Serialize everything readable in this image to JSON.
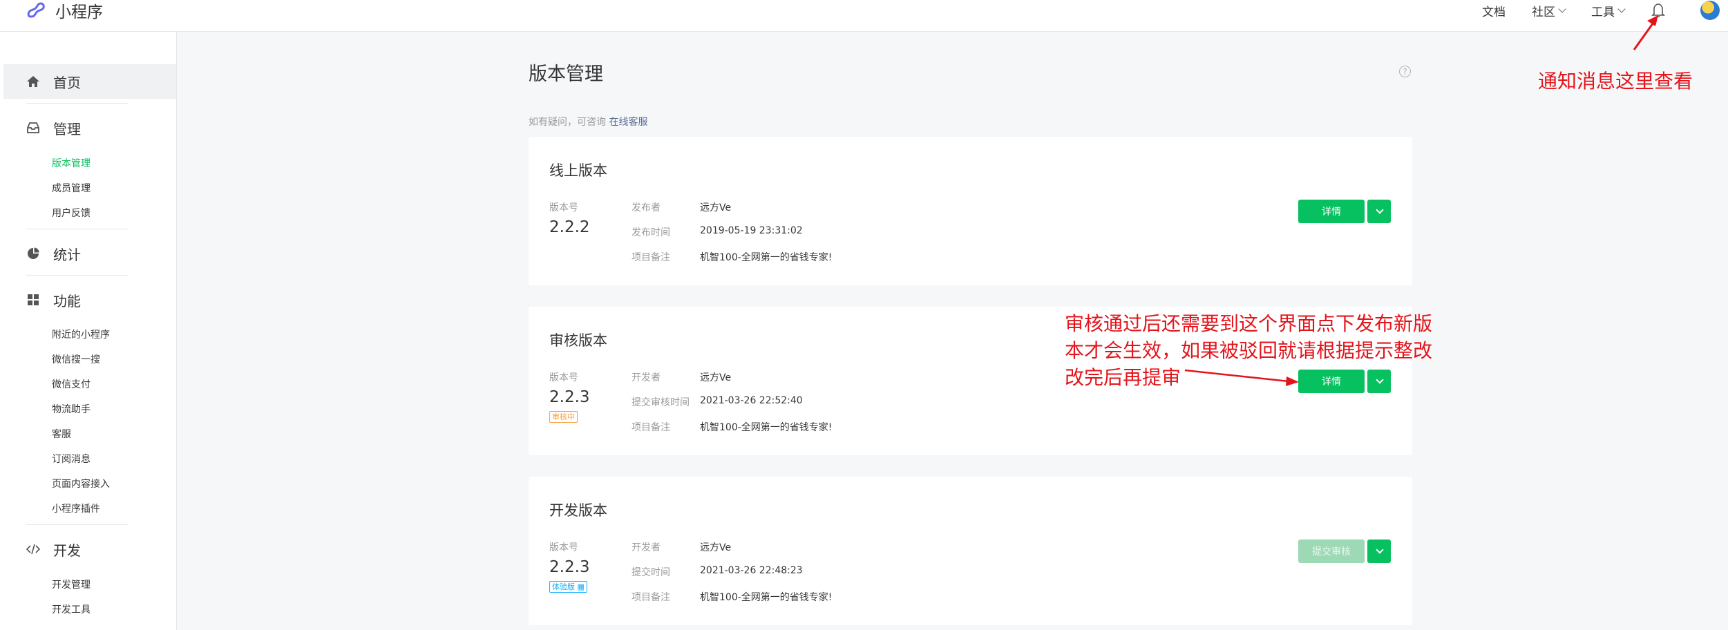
{
  "brand": {
    "name": "小程序"
  },
  "topnav": {
    "items": [
      "文档",
      "社区",
      "工具"
    ]
  },
  "sidebar": {
    "home": "首页",
    "manage": {
      "label": "管理",
      "items": [
        "版本管理",
        "成员管理",
        "用户反馈"
      ]
    },
    "stats": "统计",
    "features": {
      "label": "功能",
      "items": [
        "附近的小程序",
        "微信搜一搜",
        "微信支付",
        "物流助手",
        "客服",
        "订阅消息",
        "页面内容接入",
        "小程序插件"
      ]
    },
    "dev": {
      "label": "开发",
      "items": [
        "开发管理",
        "开发工具"
      ]
    }
  },
  "main": {
    "title": "版本管理",
    "help": "?",
    "tip": "如有疑问，可咨询",
    "tip_link": "在线客服",
    "online": {
      "title": "线上版本",
      "version_label": "版本号",
      "version": "2.2.2",
      "rows": [
        {
          "label": "发布者",
          "value": "远方Ve"
        },
        {
          "label": "发布时间",
          "value": "2019-05-19 23:31:02"
        },
        {
          "label": "项目备注",
          "value": "机智100-全网第一的省钱专家!"
        }
      ],
      "button": "详情"
    },
    "review": {
      "title": "审核版本",
      "version_label": "版本号",
      "version": "2.2.3",
      "tag": "审核中",
      "rows": [
        {
          "label": "开发者",
          "value": "远方Ve"
        },
        {
          "label": "提交审核时间",
          "value": "2021-03-26 22:52:40"
        },
        {
          "label": "项目备注",
          "value": "机智100-全网第一的省钱专家!"
        }
      ],
      "button": "详情"
    },
    "develop": {
      "title": "开发版本",
      "version_label": "版本号",
      "version": "2.2.3",
      "tag": "体验版",
      "rows": [
        {
          "label": "开发者",
          "value": "远方Ve"
        },
        {
          "label": "提交时间",
          "value": "2021-03-26 22:48:23"
        },
        {
          "label": "项目备注",
          "value": "机智100-全网第一的省钱专家!"
        }
      ],
      "button": "提交审核"
    }
  },
  "annotations": {
    "notice": "通知消息这里查看",
    "review_lines": [
      "审核通过后还需要到这个界面点下发布新版",
      "本才会生效，如果被驳回就请根据提示整改",
      "改完后再提审"
    ]
  },
  "colors": {
    "accent": "#07c160",
    "annotation": "#e4141b",
    "link": "#576b95"
  }
}
